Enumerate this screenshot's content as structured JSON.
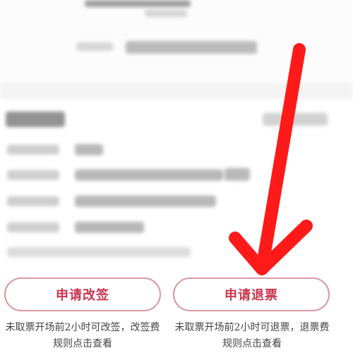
{
  "actions": {
    "change_label": "申请改签",
    "refund_label": "申请退票"
  },
  "notes": {
    "change_note": "未取票开场前2小时可改签，改签费规则点击查看",
    "refund_note": "未取票开场前2小时可退票，退票费规则点击查看"
  },
  "colors": {
    "accent": "#c9364e",
    "button_border": "#d99aa2",
    "annotation_arrow": "#ff1a1a"
  },
  "icons": {
    "annotation": "red-arrow-icon"
  }
}
